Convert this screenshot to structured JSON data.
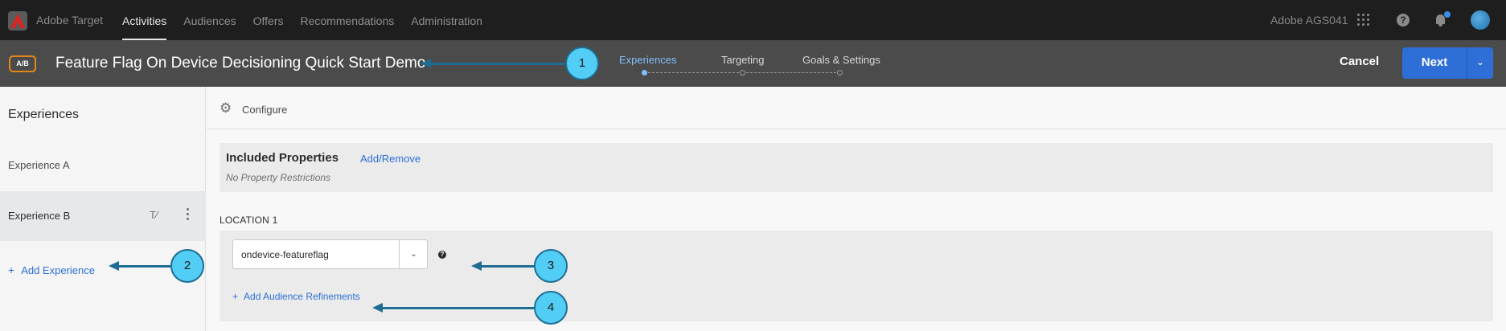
{
  "topbar": {
    "brand": "Adobe Target",
    "nav": [
      "Activities",
      "Audiences",
      "Offers",
      "Recommendations",
      "Administration"
    ],
    "active_nav": "Activities",
    "org": "Adobe AGS041",
    "help_glyph": "?"
  },
  "activity": {
    "type_badge": "A/B",
    "title": "Feature Flag On Device Decisioning Quick Start Demo",
    "steps": [
      "Experiences",
      "Targeting",
      "Goals & Settings"
    ],
    "active_step": "Experiences",
    "cancel_label": "Cancel",
    "next_label": "Next"
  },
  "sidebar": {
    "title": "Experiences",
    "items": [
      {
        "label": "Experience A"
      },
      {
        "label": "Experience B",
        "selected": true
      }
    ],
    "add_label": "Add Experience",
    "plus_glyph": "+",
    "text_icon_glyph": "T⁄"
  },
  "main": {
    "configure_label": "Configure",
    "included_properties": {
      "heading": "Included Properties",
      "link": "Add/Remove",
      "note": "No Property Restrictions"
    },
    "location": {
      "label": "LOCATION 1",
      "mbox_value": "ondevice-featureflag",
      "add_refinements": "Add Audience Refinements"
    }
  },
  "callouts": [
    "1",
    "2",
    "3",
    "4"
  ],
  "colors": {
    "accent": "#2d6fd6",
    "callout_fill": "#52cdf5",
    "callout_stroke": "#1f6d92",
    "badge_orange": "#e68619",
    "topbar": "#1e1e1e",
    "activity_bar": "#4b4b4b"
  }
}
